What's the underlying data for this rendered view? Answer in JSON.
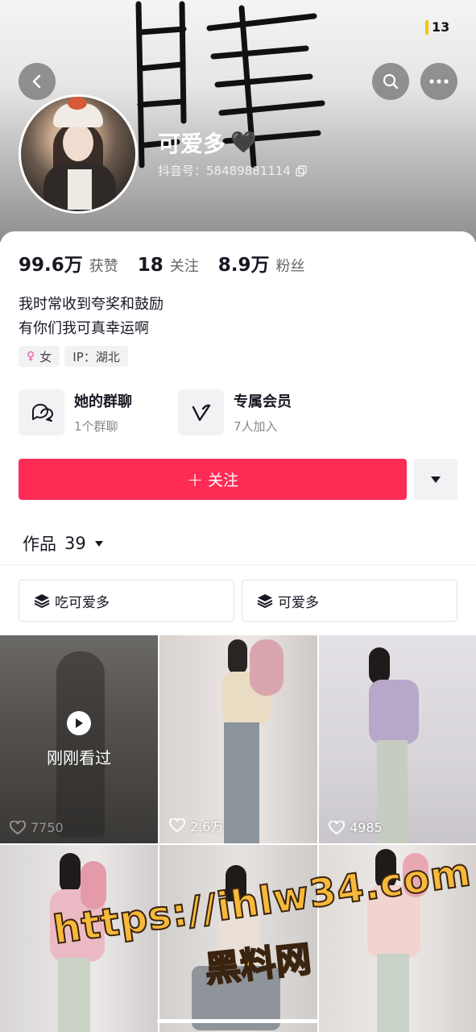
{
  "status_bar": {
    "badge": "13"
  },
  "header": {
    "back_icon": "chevron-left-icon",
    "search_icon": "search-icon",
    "more_icon": "more-dots-icon",
    "nickname": "可爱多",
    "nickname_emoji": "🖤",
    "douyin_id": "抖音号：58489881114",
    "copy_icon": "copy-icon"
  },
  "stats": [
    {
      "num": "99.6万",
      "label": "获赞"
    },
    {
      "num": "18",
      "label": "关注"
    },
    {
      "num": "8.9万",
      "label": "粉丝"
    }
  ],
  "bio": {
    "line1": "我时常收到夸奖和鼓励",
    "line2": "有你们我可真幸运啊"
  },
  "tags": {
    "gender": "女",
    "ip": "IP：湖北"
  },
  "features": [
    {
      "title": "她的群聊",
      "sub": "1个群聊",
      "icon": "chat-bubbles-icon"
    },
    {
      "title": "专属会员",
      "sub": "7人加入",
      "icon": "v-badge-icon"
    }
  ],
  "actions": {
    "follow_label": "关注",
    "follow_plus": "+"
  },
  "works": {
    "label": "作品",
    "count": "39"
  },
  "collections": [
    {
      "label": "吃可爱多"
    },
    {
      "label": "可爱多"
    }
  ],
  "videos": [
    {
      "likes": "7750",
      "overlay": "刚刚看过"
    },
    {
      "likes": "2.6万"
    },
    {
      "likes": "4985"
    },
    {
      "likes": ""
    },
    {
      "likes": ""
    },
    {
      "likes": ""
    }
  ],
  "watermark": {
    "line1": "https://ihlw34.com",
    "line2": "黑料网"
  },
  "colors": {
    "accent": "#fe2c55",
    "watermark": "#f7b93a"
  }
}
